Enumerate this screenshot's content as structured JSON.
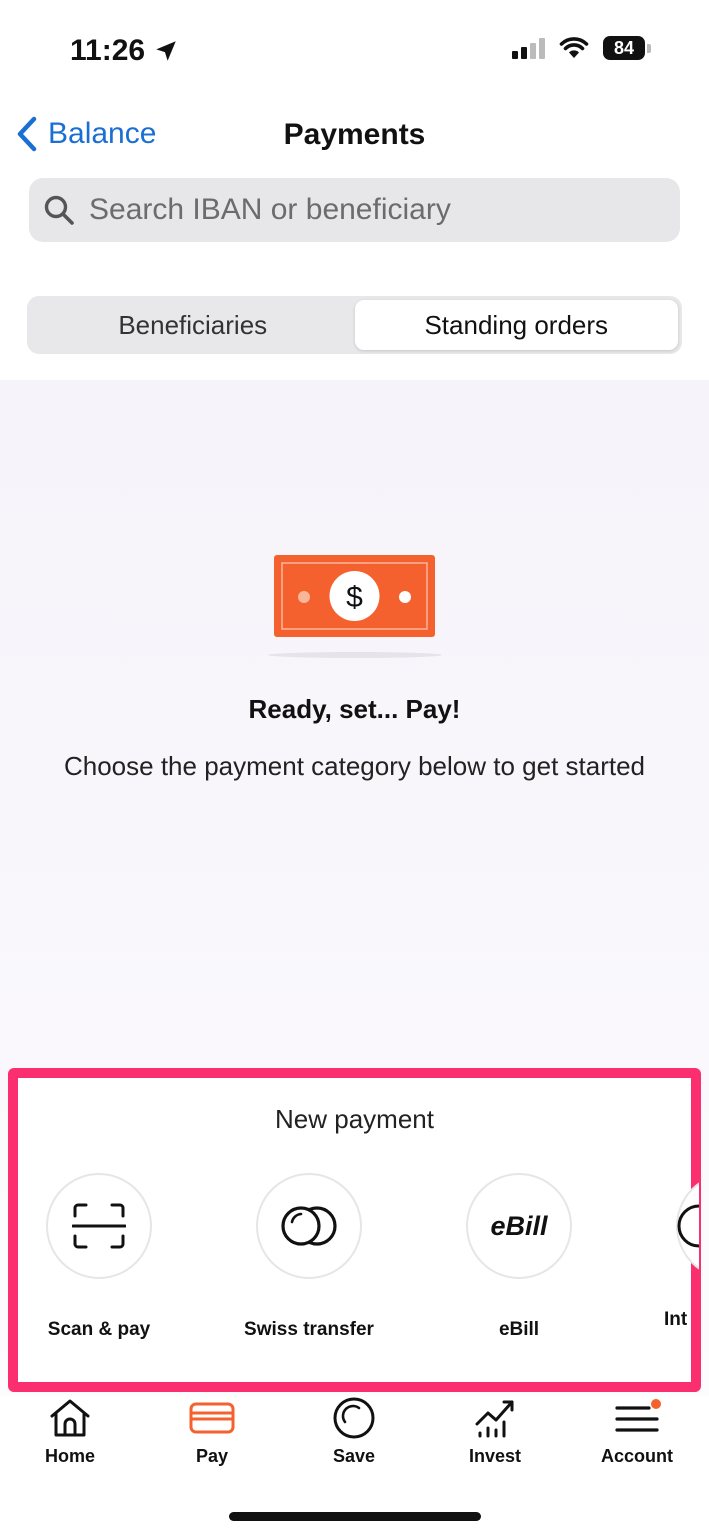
{
  "status": {
    "time": "11:26",
    "battery": "84"
  },
  "header": {
    "back_label": "Balance",
    "title": "Payments"
  },
  "search": {
    "placeholder": "Search IBAN or beneficiary"
  },
  "segments": [
    {
      "label": "Beneficiaries",
      "active": false
    },
    {
      "label": "Standing orders",
      "active": true
    }
  ],
  "empty_state": {
    "heading": "Ready, set... Pay!",
    "message": "Choose the payment category below to get started"
  },
  "new_payment": {
    "title": "New payment",
    "options": [
      {
        "label": "Scan & pay",
        "icon": "scan-icon"
      },
      {
        "label": "Swiss transfer",
        "icon": "coins-icon"
      },
      {
        "label": "eBill",
        "icon": "ebill-icon",
        "icon_text": "eBill"
      },
      {
        "label": "Int",
        "icon": "globe-icon"
      }
    ]
  },
  "tabbar": {
    "items": [
      {
        "label": "Home",
        "icon": "home-icon"
      },
      {
        "label": "Pay",
        "icon": "card-icon",
        "active": true
      },
      {
        "label": "Save",
        "icon": "save-icon"
      },
      {
        "label": "Invest",
        "icon": "invest-icon"
      },
      {
        "label": "Account",
        "icon": "menu-icon",
        "badge": true
      }
    ],
    "accent": "#f5612e"
  },
  "colors": {
    "brand_orange": "#f5612e",
    "link_blue": "#1a6fd3",
    "highlight": "#fb2e6f"
  }
}
